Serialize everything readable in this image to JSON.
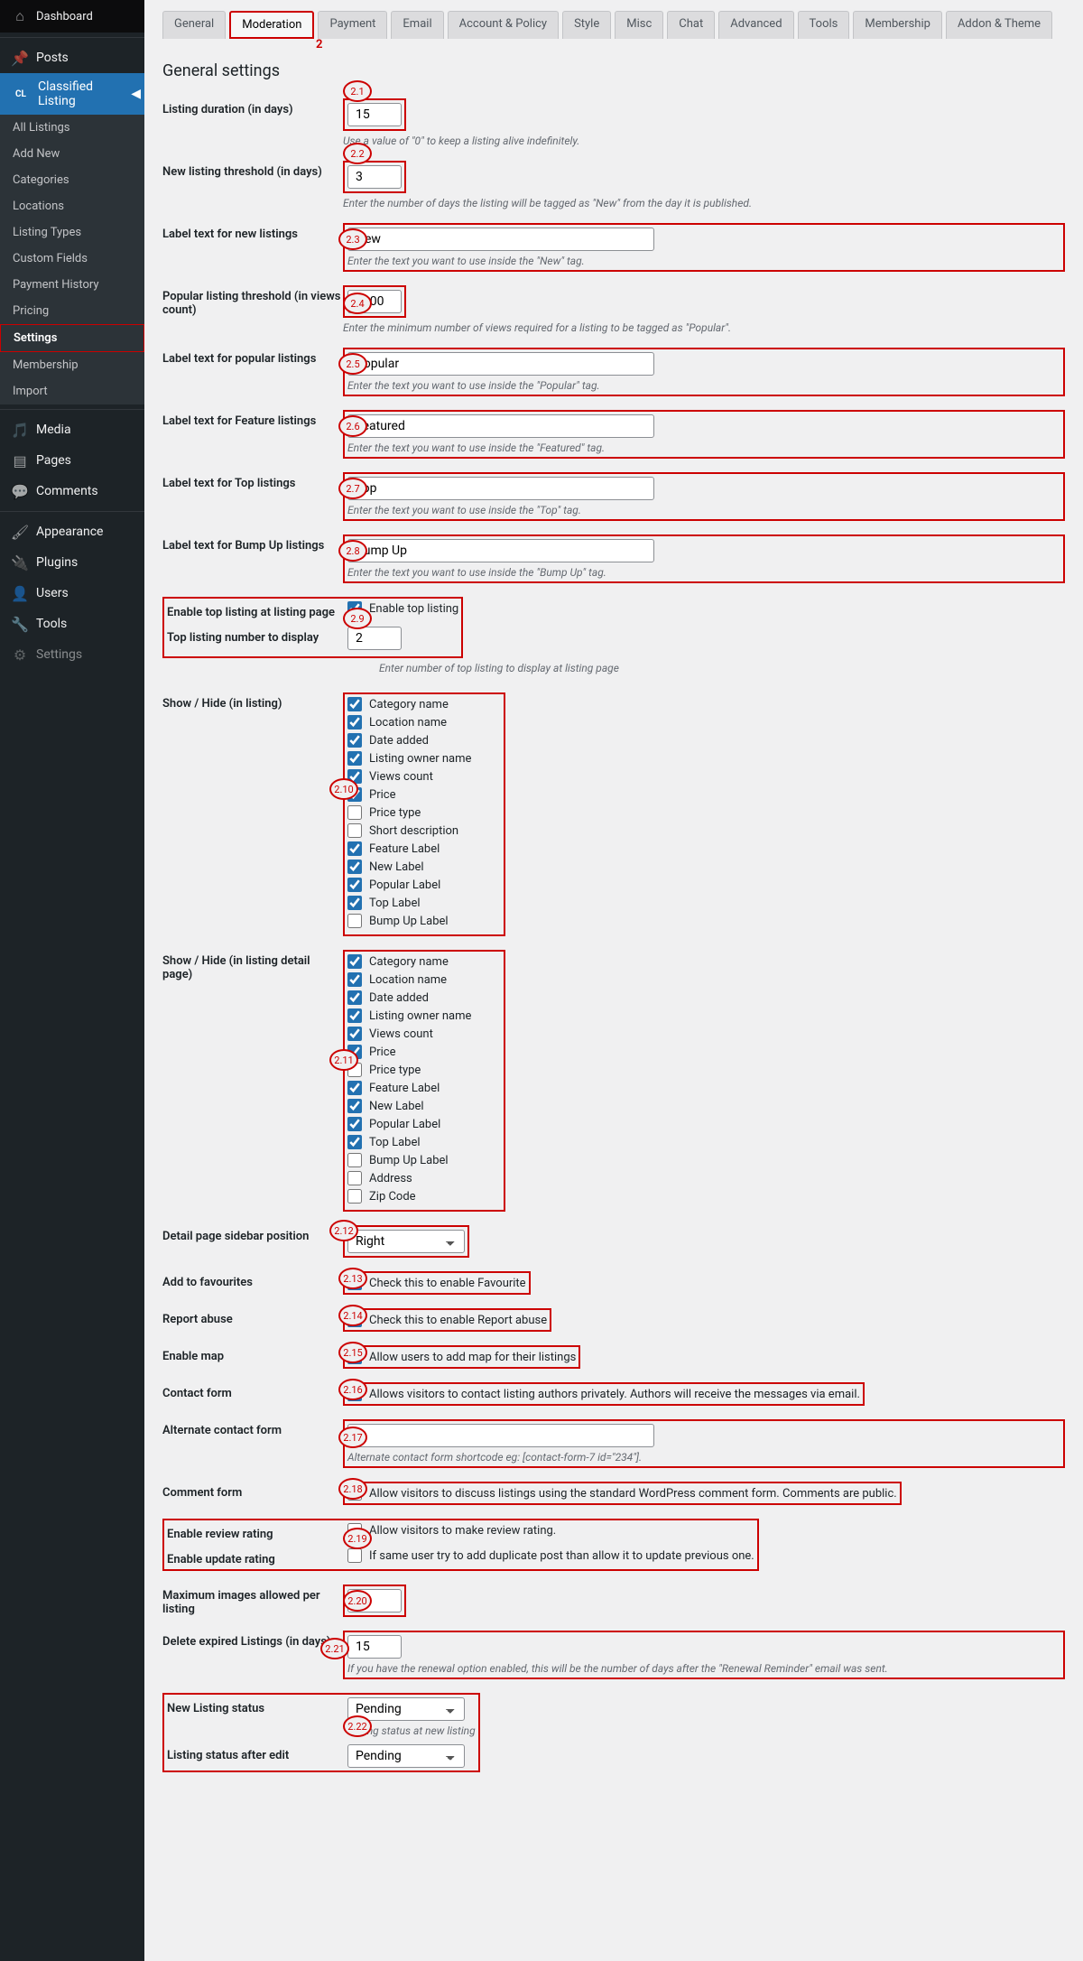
{
  "header": {
    "dashboard": "Dashboard"
  },
  "sidebar": {
    "posts": "Posts",
    "classified": "Classified Listing",
    "subs": [
      "All Listings",
      "Add New",
      "Categories",
      "Locations",
      "Listing Types",
      "Custom Fields",
      "Payment History",
      "Pricing",
      "Settings",
      "Membership",
      "Import"
    ],
    "media": "Media",
    "pages": "Pages",
    "comments": "Comments",
    "appearance": "Appearance",
    "plugins": "Plugins",
    "users": "Users",
    "tools": "Tools",
    "settings": "Settings"
  },
  "tabs": [
    "General",
    "Moderation",
    "Payment",
    "Email",
    "Account & Policy",
    "Style",
    "Misc",
    "Chat",
    "Advanced",
    "Tools",
    "Membership",
    "Addon & Theme"
  ],
  "h2": "General settings",
  "fields": {
    "listing_duration": {
      "label": "Listing duration (in days)",
      "value": "15",
      "desc": "Use a value of \"0\" to keep a listing alive indefinitely."
    },
    "new_threshold": {
      "label": "New listing threshold (in days)",
      "value": "3",
      "desc": "Enter the number of days the listing will be tagged as \"New\" from the day it is published."
    },
    "label_new": {
      "label": "Label text for new listings",
      "value": "New",
      "desc": "Enter the text you want to use inside the \"New\" tag."
    },
    "popular_threshold": {
      "label": "Popular listing threshold (in views count)",
      "value": "1000",
      "desc": "Enter the minimum number of views required for a listing to be tagged as \"Popular\"."
    },
    "label_popular": {
      "label": "Label text for popular listings",
      "value": "Popular",
      "desc": "Enter the text you want to use inside the \"Popular\" tag."
    },
    "label_feature": {
      "label": "Label text for Feature listings",
      "value": "Featured",
      "desc": "Enter the text you want to use inside the \"Featured\" tag."
    },
    "label_top": {
      "label": "Label text for Top listings",
      "value": "Top",
      "desc": "Enter the text you want to use inside the \"Top\" tag."
    },
    "label_bump": {
      "label": "Label text for Bump Up listings",
      "value": "Bump Up",
      "desc": "Enter the text you want to use inside the \"Bump Up\" tag."
    },
    "enable_top": {
      "label": "Enable top listing at listing page",
      "cb": "Enable top listing"
    },
    "top_number": {
      "label": "Top listing number to display",
      "value": "2",
      "desc": "Enter number of top listing to display at listing page"
    },
    "showhide_listing": {
      "label": "Show / Hide (in listing)",
      "opts": [
        {
          "t": "Category name",
          "c": true
        },
        {
          "t": "Location name",
          "c": true
        },
        {
          "t": "Date added",
          "c": true
        },
        {
          "t": "Listing owner name",
          "c": true
        },
        {
          "t": "Views count",
          "c": true
        },
        {
          "t": "Price",
          "c": true
        },
        {
          "t": "Price type",
          "c": false
        },
        {
          "t": "Short description",
          "c": false
        },
        {
          "t": "Feature Label",
          "c": true
        },
        {
          "t": "New Label",
          "c": true
        },
        {
          "t": "Popular Label",
          "c": true
        },
        {
          "t": "Top Label",
          "c": true
        },
        {
          "t": "Bump Up Label",
          "c": false
        }
      ]
    },
    "showhide_detail": {
      "label": "Show / Hide (in listing detail page)",
      "opts": [
        {
          "t": "Category name",
          "c": true
        },
        {
          "t": "Location name",
          "c": true
        },
        {
          "t": "Date added",
          "c": true
        },
        {
          "t": "Listing owner name",
          "c": true
        },
        {
          "t": "Views count",
          "c": true
        },
        {
          "t": "Price",
          "c": true
        },
        {
          "t": "Price type",
          "c": false
        },
        {
          "t": "Feature Label",
          "c": true
        },
        {
          "t": "New Label",
          "c": true
        },
        {
          "t": "Popular Label",
          "c": true
        },
        {
          "t": "Top Label",
          "c": true
        },
        {
          "t": "Bump Up Label",
          "c": false
        },
        {
          "t": "Address",
          "c": false
        },
        {
          "t": "Zip Code",
          "c": false
        }
      ]
    },
    "sidebar_pos": {
      "label": "Detail page sidebar position",
      "value": "Right"
    },
    "favourites": {
      "label": "Add to favourites",
      "cb": "Check this to enable Favourite"
    },
    "report": {
      "label": "Report abuse",
      "cb": "Check this to enable Report abuse"
    },
    "map": {
      "label": "Enable map",
      "cb": "Allow users to add map for their listings"
    },
    "contact": {
      "label": "Contact form",
      "cb": "Allows visitors to contact listing authors privately. Authors will receive the messages via email."
    },
    "alt_contact": {
      "label": "Alternate contact form",
      "value": "",
      "desc": "Alternate contact form shortcode eg: [contact-form-7 id=\"234\"]."
    },
    "comment": {
      "label": "Comment form",
      "cb": "Allow visitors to discuss listings using the standard WordPress comment form. Comments are public."
    },
    "review": {
      "label": "Enable review rating",
      "cb": "Allow visitors to make review rating."
    },
    "update": {
      "label": "Enable update rating",
      "cb": "If same user try to add duplicate post than allow it to update previous one."
    },
    "max_images": {
      "label": "Maximum images allowed per listing",
      "value": "5"
    },
    "delete_expired": {
      "label": "Delete expired Listings (in days)",
      "value": "15",
      "desc": "If you have the renewal option enabled, this will be the number of days after the \"Renewal Reminder\" email was sent."
    },
    "new_status": {
      "label": "New Listing status",
      "value": "Pending",
      "desc": "Listing status at new listing"
    },
    "edit_status": {
      "label": "Listing status after edit",
      "value": "Pending"
    }
  },
  "annos": {
    "tab": "2",
    "a1": "2.1",
    "a2": "2.2",
    "a3": "2.3",
    "a4": "2.4",
    "a5": "2.5",
    "a6": "2.6",
    "a7": "2.7",
    "a8": "2.8",
    "a9": "2.9",
    "a10": "2.10",
    "a11": "2.11",
    "a12": "2.12",
    "a13": "2.13",
    "a14": "2.14",
    "a15": "2.15",
    "a16": "2.16",
    "a17": "2.17",
    "a18": "2.18",
    "a19": "2.19",
    "a20": "2.20",
    "a21": "2.21",
    "a22": "2.22"
  }
}
